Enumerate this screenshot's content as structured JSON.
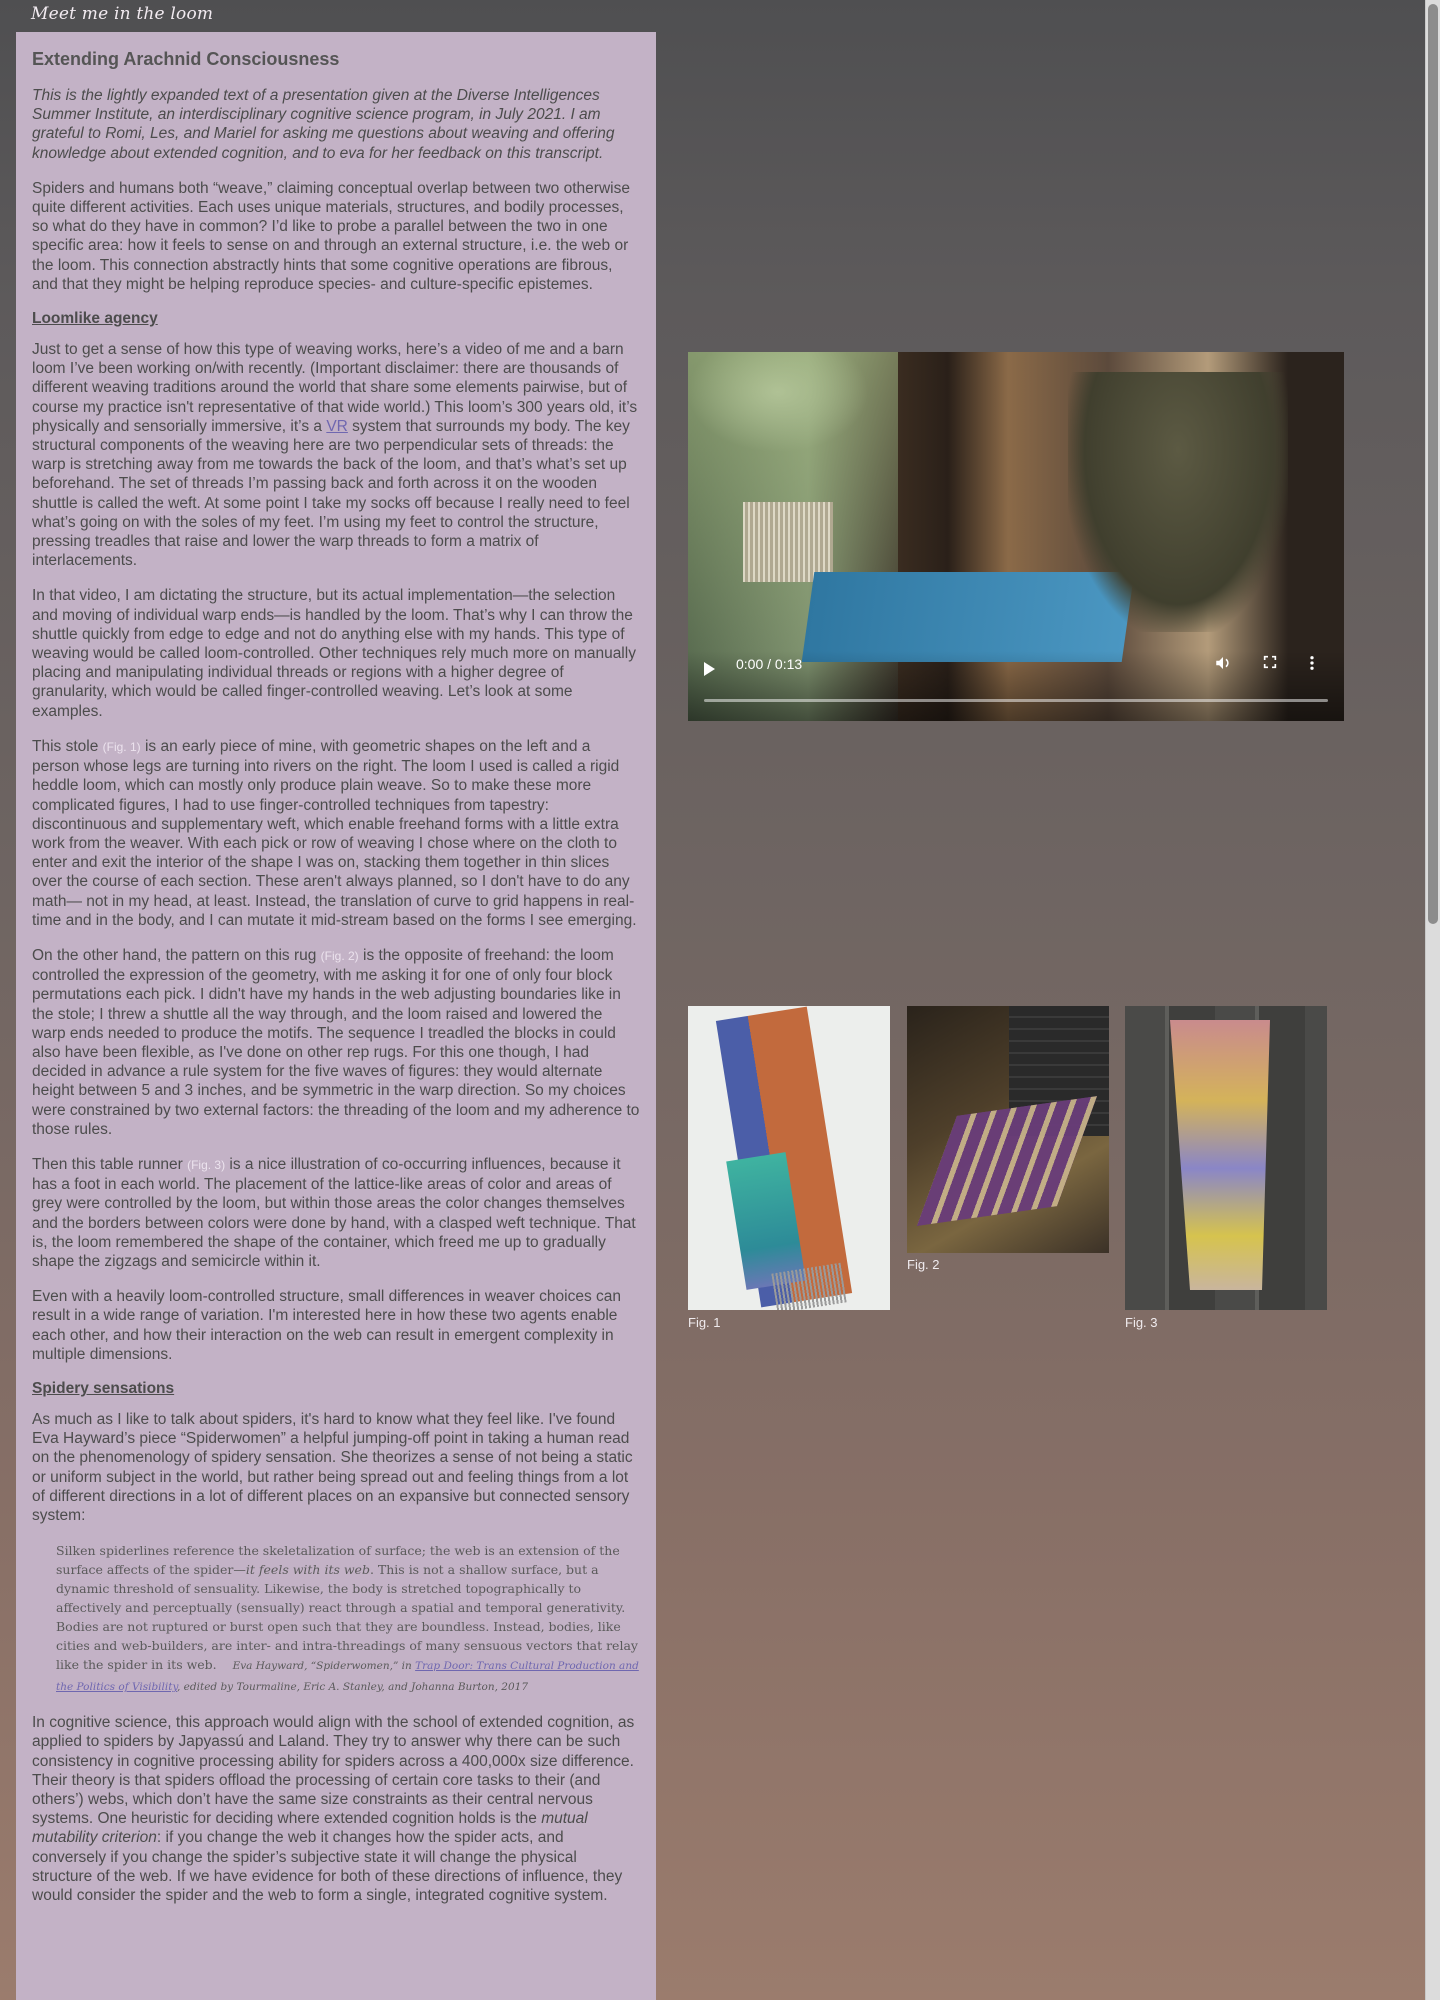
{
  "site": {
    "title": "Meet me in the loom"
  },
  "article": {
    "title": "Extending Arachnid Consciousness",
    "intro": "This is the lightly expanded text of a presentation given at the Diverse Intelligences Summer Institute, an interdisciplinary cognitive science program, in July 2021. I am grateful to Romi, Les, and Mariel for asking me questions about weaving and offering knowledge about extended cognition, and to eva for her feedback on this transcript.",
    "p1": "Spiders and humans both “weave,” claiming conceptual overlap between two otherwise quite different activities. Each uses unique materials, structures, and bodily processes, so what do they have in common? I’d like to probe a parallel between the two in one specific area: how it feels to sense on and through an external structure, i.e. the web or the loom. This connection abstractly hints that some cognitive operations are fibrous, and that they might be helping reproduce species- and culture-specific epistemes.",
    "h_loomlike": "Loomlike agency",
    "p2_before": "Just to get a sense of how this type of weaving works, here’s a video of me and a barn loom I’ve been working on/with recently. (Important disclaimer: there are thousands of different weaving traditions around the world that share some elements pairwise, but of course my practice isn't representative of that wide world.) This loom’s 300 years old, it’s physically and sensorially immersive, it’s a ",
    "p2_link": "VR",
    "p2_after": " system that surrounds my body. The key structural components of the weaving here are two perpendicular sets of threads: the warp is stretching away from me towards the back of the loom, and that’s what’s set up beforehand. The set of threads I’m passing back and forth across it on the wooden shuttle is called the weft. At some point I take my socks off because I really need to feel what’s going on with the soles of my feet. I’m using my feet to control the structure, pressing treadles that raise and lower the warp threads to form a matrix of interlacements.",
    "p3": "In that video, I am dictating the structure, but its actual implementation—the selection and moving of individual warp ends—is handled by the loom. That’s why I can throw the shuttle quickly from edge to edge and not do anything else with my hands. This type of weaving would be called loom-controlled. Other techniques rely much more on manually placing and manipulating individual threads or regions with a higher degree of granularity, which would be called finger-controlled weaving. Let’s look at some examples.",
    "p4_before": "This stole ",
    "p4_ref": "(Fig. 1)",
    "p4_after": " is an early piece of mine, with geometric shapes on the left and a person whose legs are turning into rivers on the right. The loom I used is called a rigid heddle loom, which can mostly only produce plain weave. So to make these more complicated figures, I had to use finger-controlled techniques from tapestry: discontinuous and supplementary weft, which enable freehand forms with a little extra work from the weaver. With each pick or row of weaving I chose where on the cloth to enter and exit the interior of the shape I was on, stacking them together in thin slices over the course of each section. These aren't always planned, so I don't have to do any math— not in my head, at least. Instead, the translation of curve to grid happens in real-time and in the body, and I can mutate it mid-stream based on the forms I see emerging.",
    "p5_before": "On the other hand, the pattern on this rug ",
    "p5_ref": "(Fig. 2)",
    "p5_after": " is the opposite of freehand: the loom controlled the expression of the geometry, with me asking it for one of only four block permutations each pick. I didn't have my hands in the web adjusting boundaries like in the stole; I threw a shuttle all the way through, and the loom raised and lowered the warp ends needed to produce the motifs. The sequence I treadled the blocks in could also have been flexible, as I've done on other rep rugs. For this one though, I had decided in advance a rule system for the five waves of figures: they would alternate height between 5 and 3 inches, and be symmetric in the warp direction. So my choices were constrained by two external factors: the threading of the loom and my adherence to those rules.",
    "p6_before": "Then this table runner ",
    "p6_ref": "(Fig. 3)",
    "p6_after": " is a nice illustration of co-occurring influences, because it has a foot in each world. The placement of the lattice-like areas of color and areas of grey were controlled by the loom, but within those areas the color changes themselves and the borders between colors were done by hand, with a clasped weft technique. That is, the loom remembered the shape of the container, which freed me up to gradually shape the zigzags and semicircle within it.",
    "p7": "Even with a heavily loom-controlled structure, small differences in weaver choices can result in a wide range of variation. I'm interested here in how these two agents enable each other, and how their interaction on the web can result in emergent complexity in multiple dimensions.",
    "h_spidery": "Spidery sensations",
    "p8": "As much as I like to talk about spiders, it's hard to know what they feel like. I've found Eva Hayward’s piece “Spiderwomen” a helpful jumping-off point in taking a human read on the phenomenology of spidery sensation. She theorizes a sense of not being a static or uniform subject in the world, but rather being spread out and feeling things from a lot of different directions in a lot of different places on an expansive but connected sensory system:",
    "quote_before": "Silken spiderlines reference the skeletalization of surface; the web is an extension of the surface affects of the spider—",
    "quote_em": "it feels with its web",
    "quote_after": ". This is not a shallow surface, but a dynamic threshold of sensuality. Likewise, the body is stretched topographically to affectively and perceptually (sensually) react through a spatial and temporal generativity. Bodies are not ruptured or burst open such that they are boundless. Instead, bodies, like cities and web-builders, are inter- and intra-threadings of many sensuous vectors that relay like the spider in its web.",
    "cite_before": "Eva Hayward, “Spiderwomen,” in ",
    "cite_link": "Trap Door: Trans Cultural Production and the Politics of Visibility",
    "cite_after": ", edited by Tourmaline, Eric A. Stanley, and Johanna Burton, 2017",
    "p9_before": "In cognitive science, this approach would align with the school of extended cognition, as applied to spiders by Japyassú and Laland. They try to answer why there can be such consistency in cognitive processing ability for spiders across a 400,000x size difference. Their theory is that spiders offload the processing of certain core tasks to their (and others’) webs, which don’t have the same size constraints as their central nervous systems. One heuristic for deciding where extended cognition holds is the ",
    "p9_em": "mutual mutability criterion",
    "p9_after": ": if you change the web it changes how the spider acts, and conversely if you change the spider’s subjective state it will change the physical structure of the web. If we have evidence for both of these directions of influence, they would consider the spider and the web to form a single, integrated cognitive system."
  },
  "video": {
    "time": "0:00 / 0:13",
    "progress": 0
  },
  "figures": [
    {
      "caption": "Fig. 1"
    },
    {
      "caption": "Fig. 2"
    },
    {
      "caption": "Fig. 3"
    }
  ],
  "icons": {
    "play": "play-icon",
    "volume": "volume-icon",
    "fullscreen": "fullscreen-icon",
    "more": "more-vertical-icon"
  }
}
